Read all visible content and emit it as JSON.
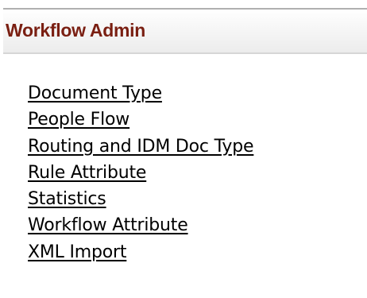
{
  "header": {
    "title": "Workflow Admin"
  },
  "links": [
    {
      "label": "Document Type"
    },
    {
      "label": "People Flow"
    },
    {
      "label": "Routing and IDM Doc Type"
    },
    {
      "label": "Rule Attribute"
    },
    {
      "label": "Statistics"
    },
    {
      "label": "Workflow Attribute"
    },
    {
      "label": "XML Import"
    }
  ],
  "colors": {
    "header_title": "#7a1f12",
    "link": "#000000",
    "header_border": "#b0b0b0"
  }
}
